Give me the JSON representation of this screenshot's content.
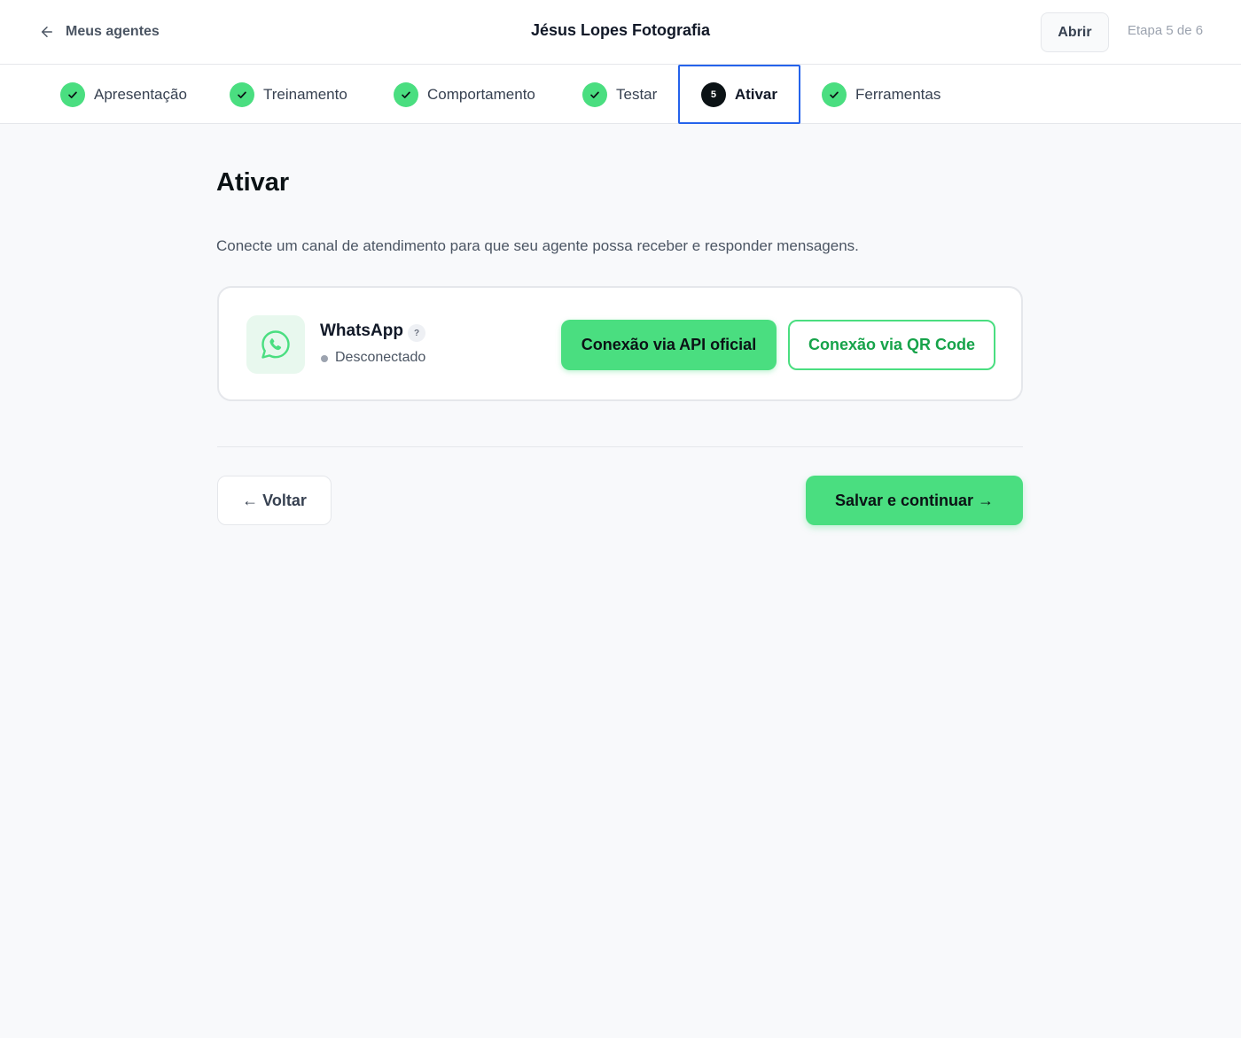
{
  "header": {
    "back_label": "Meus agentes",
    "title": "Jésus Lopes Fotografia",
    "open_label": "Abrir",
    "step_counter": "Etapa 5 de 6"
  },
  "steps": [
    {
      "label": "Apresentação",
      "state": "done"
    },
    {
      "label": "Treinamento",
      "state": "done"
    },
    {
      "label": "Comportamento",
      "state": "done"
    },
    {
      "label": "Testar",
      "state": "done"
    },
    {
      "label": "Ativar",
      "state": "active",
      "number": "5"
    },
    {
      "label": "Ferramentas",
      "state": "done"
    }
  ],
  "main": {
    "title": "Ativar",
    "description": "Conecte um canal de atendimento para que seu agente possa receber e responder mensagens.",
    "channel": {
      "icon": "whatsapp-icon",
      "name": "WhatsApp",
      "help": "?",
      "status": "Desconectado",
      "api_button": "Conexão via API oficial",
      "qr_button": "Conexão via QR Code"
    },
    "back_button": "← Voltar",
    "save_button": "Salvar e continuar →"
  },
  "colors": {
    "accent": "#4ade80",
    "accent_text": "#16a34a",
    "active_border": "#2563eb",
    "active_number_bg": "#0b1215"
  }
}
